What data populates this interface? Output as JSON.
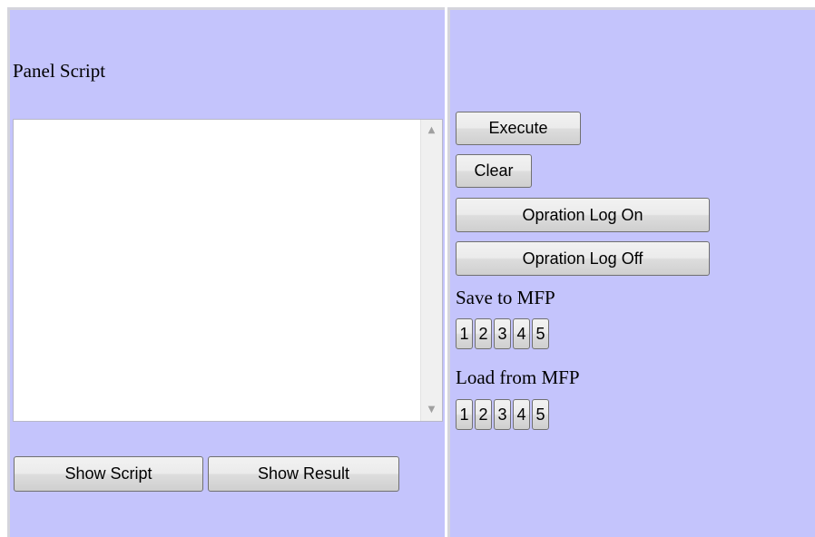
{
  "left_panel": {
    "title": "Panel Script",
    "script_text": "",
    "show_script_label": "Show Script",
    "show_result_label": "Show Result"
  },
  "right_panel": {
    "execute_label": "Execute",
    "clear_label": "Clear",
    "log_on_label": "Opration Log On",
    "log_off_label": "Opration Log Off",
    "save_section_label": "Save to MFP",
    "load_section_label": "Load from MFP",
    "save_slots": [
      "1",
      "2",
      "3",
      "4",
      "5"
    ],
    "load_slots": [
      "1",
      "2",
      "3",
      "4",
      "5"
    ]
  },
  "icons": {
    "scroll_up": "scroll-up-arrow",
    "scroll_down": "scroll-down-arrow"
  },
  "colors": {
    "panel_background": "#c4c4fc",
    "frame_border": "#d4d4dc"
  }
}
